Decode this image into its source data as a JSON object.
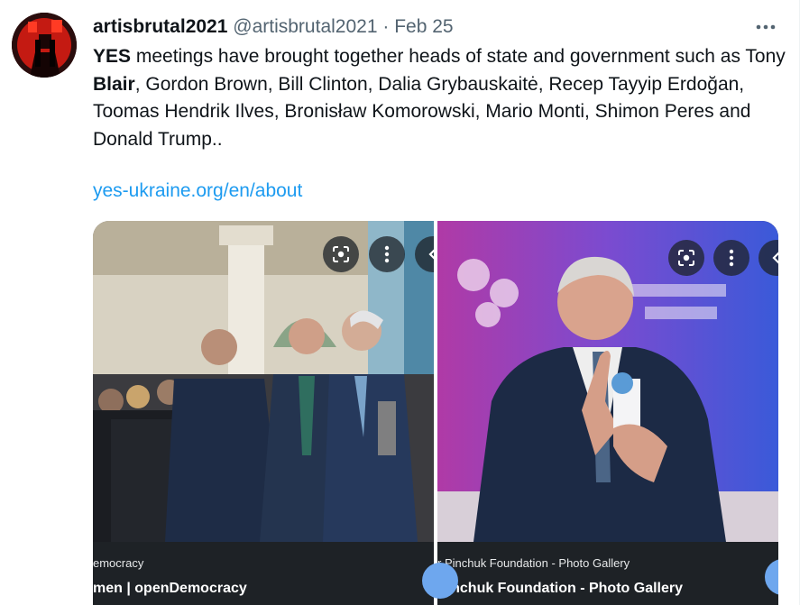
{
  "tweet": {
    "display_name": "artisbrutal2021",
    "handle": "@artisbrutal2021",
    "separator": " · ",
    "date": "Feb 25",
    "text_parts": {
      "p1": "YES",
      "p2": " meetings have brought together heads of state and government such as Tony ",
      "p3": "Blair",
      "p4": ", Gordon Brown, Bill Clinton, Dalia Grybauskaitė, Recep Tayyip Erdoğan, Toomas Hendrik Ilves, Bronisław Komorowski, Mario Monti, Shimon Peres and Donald Trump.."
    },
    "link": "yes-ukraine.org/en/about"
  },
  "cards": [
    {
      "source": "emocracy",
      "title": "men | openDemocracy"
    },
    {
      "source": "r Pinchuk Foundation - Photo Gallery",
      "title": "Pinchuk Foundation - Photo Gallery"
    }
  ],
  "icons": {
    "more": "more-horizontal-icon",
    "lens": "google-lens-icon",
    "menu": "more-vertical-icon",
    "chevron": "chevron-left-icon"
  },
  "colors": {
    "link": "#1d9bf0",
    "muted": "#536471",
    "caption_bg": "#1e2226"
  }
}
